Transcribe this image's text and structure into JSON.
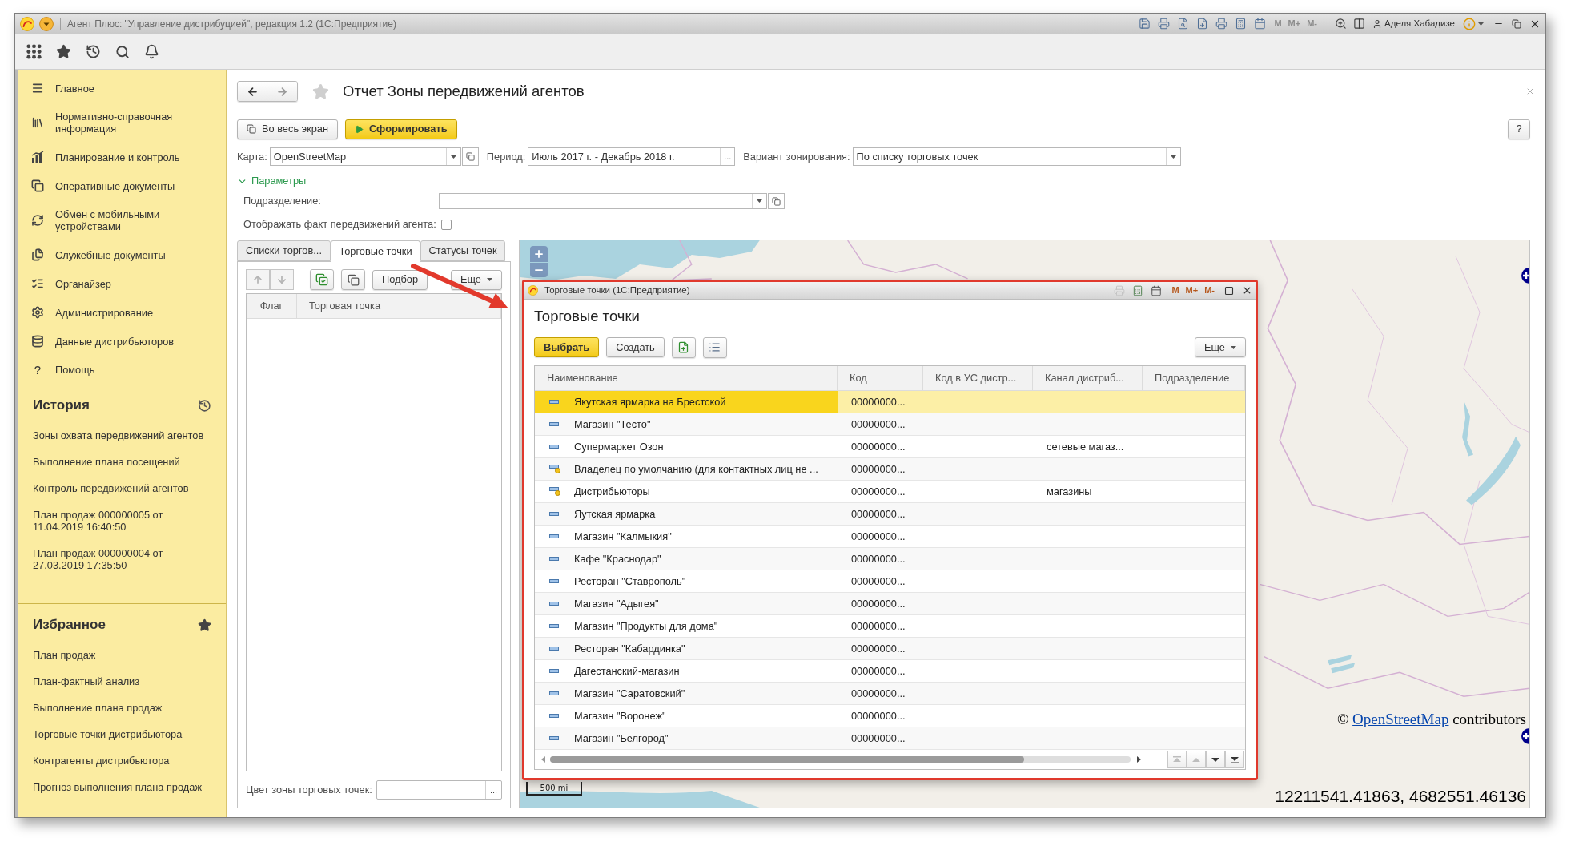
{
  "window": {
    "title": "Агент Плюс: \"Управление дистрибуцией\", редакция 1.2 (1С:Предприятие)",
    "memory_keys": [
      {
        "label": "M",
        "disabled": true
      },
      {
        "label": "M+",
        "disabled": true
      },
      {
        "label": "M-",
        "disabled": true
      }
    ],
    "user": "Аделя Хабадизе"
  },
  "sidebar": {
    "items": [
      {
        "label": "Главное"
      },
      {
        "label": "Нормативно-справочная информация"
      },
      {
        "label": "Планирование и контроль"
      },
      {
        "label": "Оперативные документы"
      },
      {
        "label": "Обмен с мобильными устройствами"
      },
      {
        "label": "Служебные документы"
      },
      {
        "label": "Органайзер"
      },
      {
        "label": "Администрирование"
      },
      {
        "label": "Данные дистрибьюторов"
      },
      {
        "label": "Помощь",
        "glyph": "?"
      }
    ],
    "history": {
      "title": "История",
      "items": [
        "Зоны охвата передвижений агентов",
        "Выполнение плана посещений",
        "Контроль передвижений агентов",
        "План продаж 000000005 от 11.04.2019 16:40:50",
        "План продаж 000000004 от 27.03.2019 17:35:50"
      ]
    },
    "favorites": {
      "title": "Избранное",
      "items": [
        "План продаж",
        "План-фактный анализ",
        "Выполнение плана продаж",
        "Торговые точки дистрибьютора",
        "Контрагенты дистрибьютора",
        "Прогноз выполнения плана продаж"
      ]
    }
  },
  "report": {
    "title": "Отчет Зоны передвижений агентов",
    "actions": [
      {
        "label": "Во весь экран",
        "kind": "expand"
      },
      {
        "label": "Сформировать",
        "kind": "run"
      }
    ],
    "help": "?",
    "fields": [
      {
        "label": "Карта:",
        "value": "OpenStreetMap",
        "kind": "combo"
      },
      {
        "label": "Период:",
        "value": "Июль 2017 г. - Декабрь 2018 г.",
        "kind": "choice",
        "button": "..."
      },
      {
        "label": "Вариант зонирования:",
        "value": "По списку торговых точек",
        "kind": "dropdown"
      }
    ],
    "parameters": {
      "label": "Параметры",
      "expanded": true,
      "department": {
        "label": "Подразделение:"
      },
      "show_movements": {
        "label": "Отображать факт передвижений агента:",
        "checked": false
      }
    },
    "tabs": [
      {
        "label": "Списки торгов...",
        "selected": false
      },
      {
        "label": "Торговые точки",
        "selected": true
      },
      {
        "label": "Статусы точек",
        "selected": false
      }
    ],
    "panel": {
      "move_buttons": [
        {
          "disabled": true
        },
        {
          "disabled": true
        }
      ],
      "buttons": [
        {
          "label": "Подбор",
          "kind": "default"
        },
        {
          "label": "Еще",
          "kind": "menu"
        }
      ],
      "columns": [
        "Флаг",
        "Торговая точка"
      ],
      "color_field": {
        "label": "Цвет зоны торговых точек:",
        "button": "..."
      }
    }
  },
  "map": {
    "scale": "500 mi",
    "attribution": {
      "prefix": "©",
      "link": "OpenStreetMap",
      "suffix": "contributors"
    },
    "coordinates": "12211541.41863, 4682551.46136"
  },
  "dialog": {
    "window_title": "Торговые точки (1С:Предприятие)",
    "memory_keys": [
      {
        "label": "M",
        "disabled": false
      },
      {
        "label": "M+",
        "disabled": false
      },
      {
        "label": "M-",
        "disabled": false
      }
    ],
    "title": "Торговые точки",
    "actions": [
      {
        "label": "Выбрать",
        "kind": "primary"
      },
      {
        "label": "Создать",
        "kind": "default"
      }
    ],
    "more": {
      "label": "Еще",
      "kind": "menu"
    },
    "columns": [
      "Наименование",
      "Код",
      "Код в УС дистр...",
      "Канал дистриб...",
      "Подразделение"
    ],
    "rows": [
      {
        "kind": "item",
        "name": "Якутская ярмарка на Брестской",
        "code": "00000000...",
        "selected": true
      },
      {
        "kind": "item",
        "name": "Магазин \"Тесто\"",
        "code": "00000000...",
        "selected": false
      },
      {
        "kind": "item",
        "name": "Супермаркет Озон",
        "code": "00000000...",
        "channel": "сетевые магаз...",
        "selected": false
      },
      {
        "kind": "group",
        "name": "Владелец по умолчанию (для контактных лиц не ...",
        "code": "00000000...",
        "selected": false
      },
      {
        "kind": "group",
        "name": "Дистрибьюторы",
        "code": "00000000...",
        "channel": "магазины",
        "selected": false
      },
      {
        "kind": "item",
        "name": "Яутская ярмарка",
        "code": "00000000...",
        "selected": false
      },
      {
        "kind": "item",
        "name": "Магазин \"Калмыкия\"",
        "code": "00000000...",
        "selected": false
      },
      {
        "kind": "item",
        "name": "Кафе \"Краснодар\"",
        "code": "00000000...",
        "selected": false
      },
      {
        "kind": "item",
        "name": "Ресторан \"Ставрополь\"",
        "code": "00000000...",
        "selected": false
      },
      {
        "kind": "item",
        "name": "Магазин \"Адыгея\"",
        "code": "00000000...",
        "selected": false
      },
      {
        "kind": "item",
        "name": "Магазин \"Продукты для дома\"",
        "code": "00000000...",
        "selected": false
      },
      {
        "kind": "item",
        "name": "Ресторан \"Кабардинка\"",
        "code": "00000000...",
        "selected": false
      },
      {
        "kind": "item",
        "name": "Дагестанский-магазин",
        "code": "00000000...",
        "selected": false
      },
      {
        "kind": "item",
        "name": "Магазин \"Саратовский\"",
        "code": "00000000...",
        "selected": false
      },
      {
        "kind": "item",
        "name": "Магазин \"Воронеж\"",
        "code": "00000000...",
        "selected": false
      },
      {
        "kind": "item",
        "name": "Магазин \"Белгород\"",
        "code": "00000000...",
        "selected": false
      }
    ],
    "row_navigation": [
      {
        "disabled": true
      },
      {
        "disabled": true
      },
      {
        "disabled": false
      },
      {
        "disabled": false
      }
    ]
  }
}
